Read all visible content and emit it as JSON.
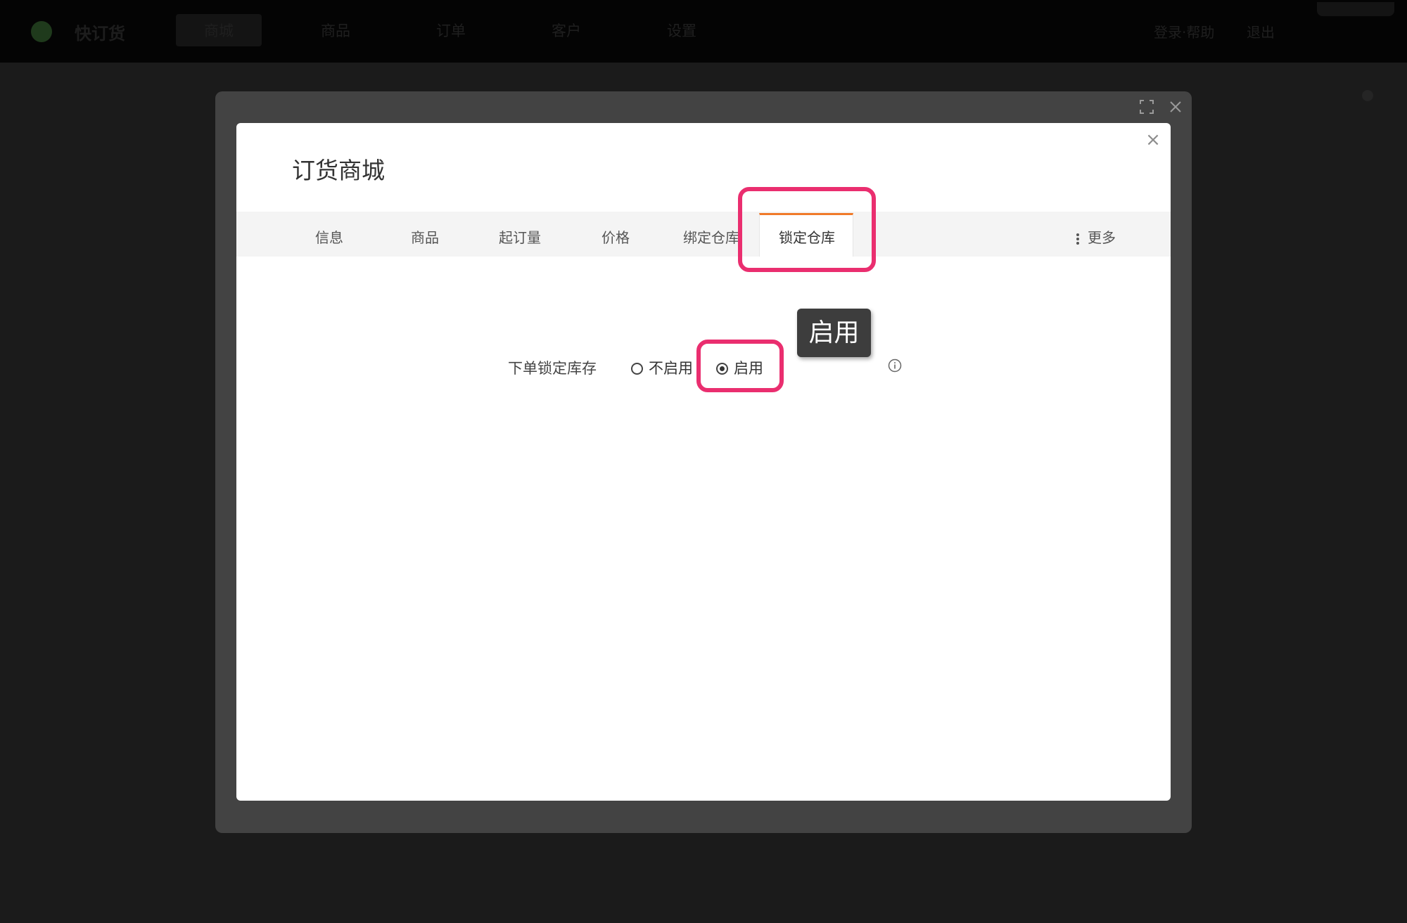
{
  "topbar": {
    "logo_text": "快订货",
    "nav_items": [
      "商城",
      "商品",
      "订单",
      "客户",
      "设置"
    ],
    "right_items": [
      "登录·帮助",
      "退出"
    ]
  },
  "dialog": {
    "title": "订货商城",
    "close_glyph": "×",
    "tabs": [
      {
        "label": "信息"
      },
      {
        "label": "商品"
      },
      {
        "label": "起订量"
      },
      {
        "label": "价格"
      },
      {
        "label": "绑定仓库"
      }
    ],
    "active_tab": "锁定仓库",
    "more_label": "更多"
  },
  "form": {
    "field_label": "下单锁定库存",
    "options": [
      {
        "label": "不启用",
        "checked": false
      },
      {
        "label": "启用",
        "checked": true
      }
    ]
  },
  "tooltip": {
    "text": "启用"
  },
  "colors": {
    "accent": "#f07a2a",
    "highlight": "#ea2e6f",
    "backdrop": "#1b1b1b",
    "frame": "#434343"
  },
  "icons": {
    "expand": "expand-icon",
    "close": "close-icon",
    "info": "info-icon",
    "more": "vertical-dots-icon"
  }
}
